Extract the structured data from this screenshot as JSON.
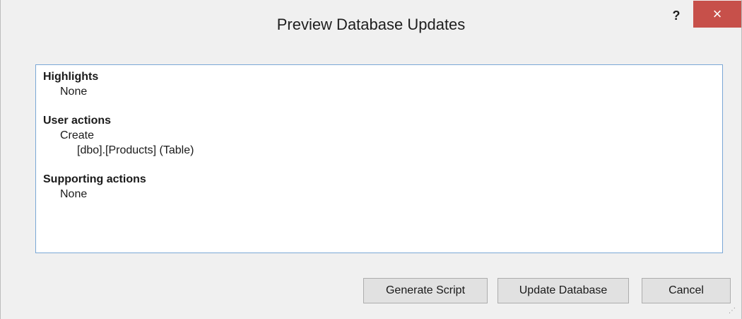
{
  "window": {
    "title": "Preview Database Updates",
    "help_label": "?",
    "close_label": "×"
  },
  "content": {
    "sections": [
      {
        "heading": "Highlights",
        "items": [
          "None"
        ]
      },
      {
        "heading": "User actions",
        "action": "Create",
        "object": "[dbo].[Products] (Table)"
      },
      {
        "heading": "Supporting actions",
        "items": [
          "None"
        ]
      }
    ]
  },
  "buttons": {
    "generate_script": "Generate Script",
    "update_database": "Update Database",
    "cancel": "Cancel"
  },
  "colors": {
    "close_button": "#c7504a",
    "list_border": "#7aa7d6",
    "window_bg": "#f0f0f0"
  }
}
